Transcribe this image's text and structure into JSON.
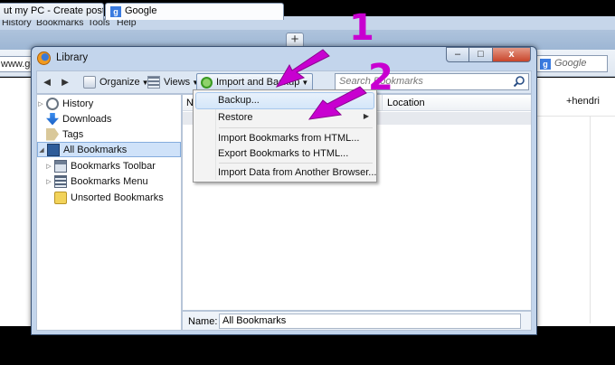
{
  "browser": {
    "menubar": [
      "History",
      "Bookmarks",
      "Tools",
      "Help"
    ],
    "tabs": [
      {
        "label": "ut my PC - Create post"
      },
      {
        "label": "Google"
      }
    ],
    "new_tab_label": "+",
    "url_fragment": "www.goog",
    "search_placeholder": "Google",
    "user": "+hendri"
  },
  "library": {
    "title": "Library",
    "controls": {
      "minimize": "–",
      "maximize": "□",
      "close": "x"
    },
    "toolbar": {
      "back": "◄",
      "forward": "►",
      "organize": "Organize",
      "views": "Views",
      "import_backup": "Import and Backup",
      "search_placeholder": "Search Bookmarks"
    },
    "sidebar": [
      {
        "label": "History",
        "icon": "history-icon",
        "expandable": true
      },
      {
        "label": "Downloads",
        "icon": "downloads-icon",
        "expandable": false
      },
      {
        "label": "Tags",
        "icon": "tags-icon",
        "expandable": false
      },
      {
        "label": "All Bookmarks",
        "icon": "all-bookmarks-icon",
        "expandable": true,
        "selected": true
      },
      {
        "label": "Bookmarks Toolbar",
        "icon": "bookmarks-toolbar-icon",
        "expandable": true
      },
      {
        "label": "Bookmarks Menu",
        "icon": "bookmarks-menu-icon",
        "expandable": true
      },
      {
        "label": "Unsorted Bookmarks",
        "icon": "unsorted-bookmarks-icon",
        "expandable": false
      }
    ],
    "columns": {
      "name": "Na",
      "location": "Location"
    },
    "details": {
      "label": "Name:",
      "value": "All Bookmarks"
    }
  },
  "import_menu": {
    "items": [
      {
        "label": "Backup...",
        "hover": true
      },
      {
        "label": "Restore",
        "submenu": true
      },
      {
        "label": "Import Bookmarks from HTML..."
      },
      {
        "label": "Export Bookmarks to HTML..."
      },
      {
        "label": "Import Data from Another Browser..."
      }
    ]
  },
  "annotations": {
    "step1": "1",
    "step2": "2",
    "color": "#c800d0"
  }
}
